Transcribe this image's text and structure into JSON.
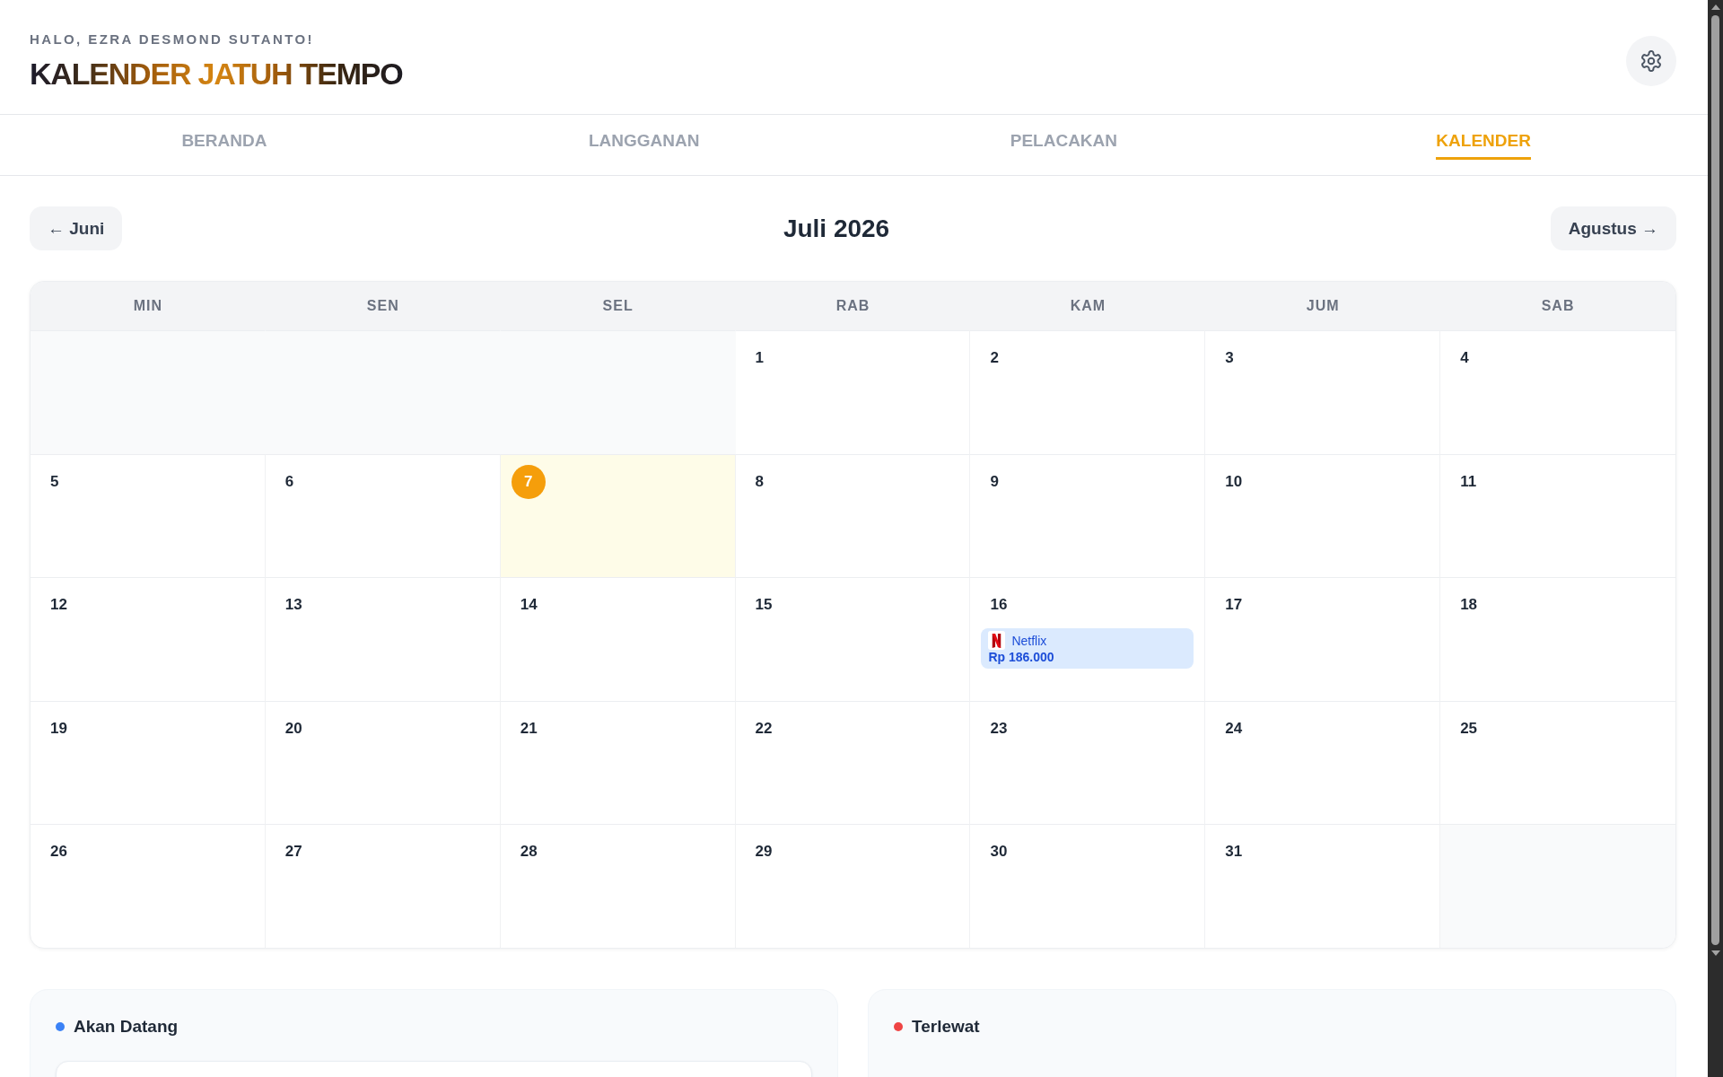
{
  "header": {
    "greeting": "HALO, EZRA DESMOND SUTANTO!",
    "title": "KALENDER JATUH TEMPO"
  },
  "tabs": [
    {
      "label": "BERANDA",
      "selected": false
    },
    {
      "label": "LANGGANAN",
      "selected": false
    },
    {
      "label": "PELACAKAN",
      "selected": false
    },
    {
      "label": "KALENDER",
      "selected": true
    }
  ],
  "month_nav": {
    "previous": "← Juni",
    "title": "Juli 2026",
    "next": "Agustus →"
  },
  "calendar": {
    "weekdays": [
      "MIN",
      "SEN",
      "SEL",
      "RAB",
      "KAM",
      "JUM",
      "SAB"
    ],
    "weeks": [
      {
        "days": [
          {
            "kind": "blank"
          },
          {
            "kind": "blank"
          },
          {
            "kind": "blank"
          },
          {
            "kind": "day",
            "day": "1",
            "today": false
          },
          {
            "kind": "day",
            "day": "2",
            "today": false
          },
          {
            "kind": "day",
            "day": "3",
            "today": false
          },
          {
            "kind": "day",
            "day": "4",
            "today": false
          }
        ]
      },
      {
        "days": [
          {
            "kind": "day",
            "day": "5",
            "today": false
          },
          {
            "kind": "day",
            "day": "6",
            "today": false
          },
          {
            "kind": "day",
            "day": "7",
            "today": true
          },
          {
            "kind": "day",
            "day": "8",
            "today": false
          },
          {
            "kind": "day",
            "day": "9",
            "today": false
          },
          {
            "kind": "day",
            "day": "10",
            "today": false
          },
          {
            "kind": "day",
            "day": "11",
            "today": false
          }
        ]
      },
      {
        "days": [
          {
            "kind": "day",
            "day": "12",
            "today": false
          },
          {
            "kind": "day",
            "day": "13",
            "today": false
          },
          {
            "kind": "day",
            "day": "14",
            "today": false
          },
          {
            "kind": "day",
            "day": "15",
            "today": false
          },
          {
            "kind": "day",
            "day": "16",
            "today": false,
            "events": [
              {
                "name": "Netflix",
                "amount": "Rp 186.000"
              }
            ]
          },
          {
            "kind": "day",
            "day": "17",
            "today": false
          },
          {
            "kind": "day",
            "day": "18",
            "today": false
          }
        ]
      },
      {
        "days": [
          {
            "kind": "day",
            "day": "19",
            "today": false
          },
          {
            "kind": "day",
            "day": "20",
            "today": false
          },
          {
            "kind": "day",
            "day": "21",
            "today": false
          },
          {
            "kind": "day",
            "day": "22",
            "today": false
          },
          {
            "kind": "day",
            "day": "23",
            "today": false
          },
          {
            "kind": "day",
            "day": "24",
            "today": false
          },
          {
            "kind": "day",
            "day": "25",
            "today": false
          }
        ]
      },
      {
        "days": [
          {
            "kind": "day",
            "day": "26",
            "today": false
          },
          {
            "kind": "day",
            "day": "27",
            "today": false
          },
          {
            "kind": "day",
            "day": "28",
            "today": false
          },
          {
            "kind": "day",
            "day": "29",
            "today": false
          },
          {
            "kind": "day",
            "day": "30",
            "today": false
          },
          {
            "kind": "day",
            "day": "31",
            "today": false
          },
          {
            "kind": "blank"
          }
        ]
      }
    ]
  },
  "panels": [
    {
      "title": "Akan Datang",
      "color": "#3b82f6",
      "entry_card": true
    },
    {
      "title": "Terlewat",
      "color": "#ef4444",
      "entry_card": false
    }
  ]
}
